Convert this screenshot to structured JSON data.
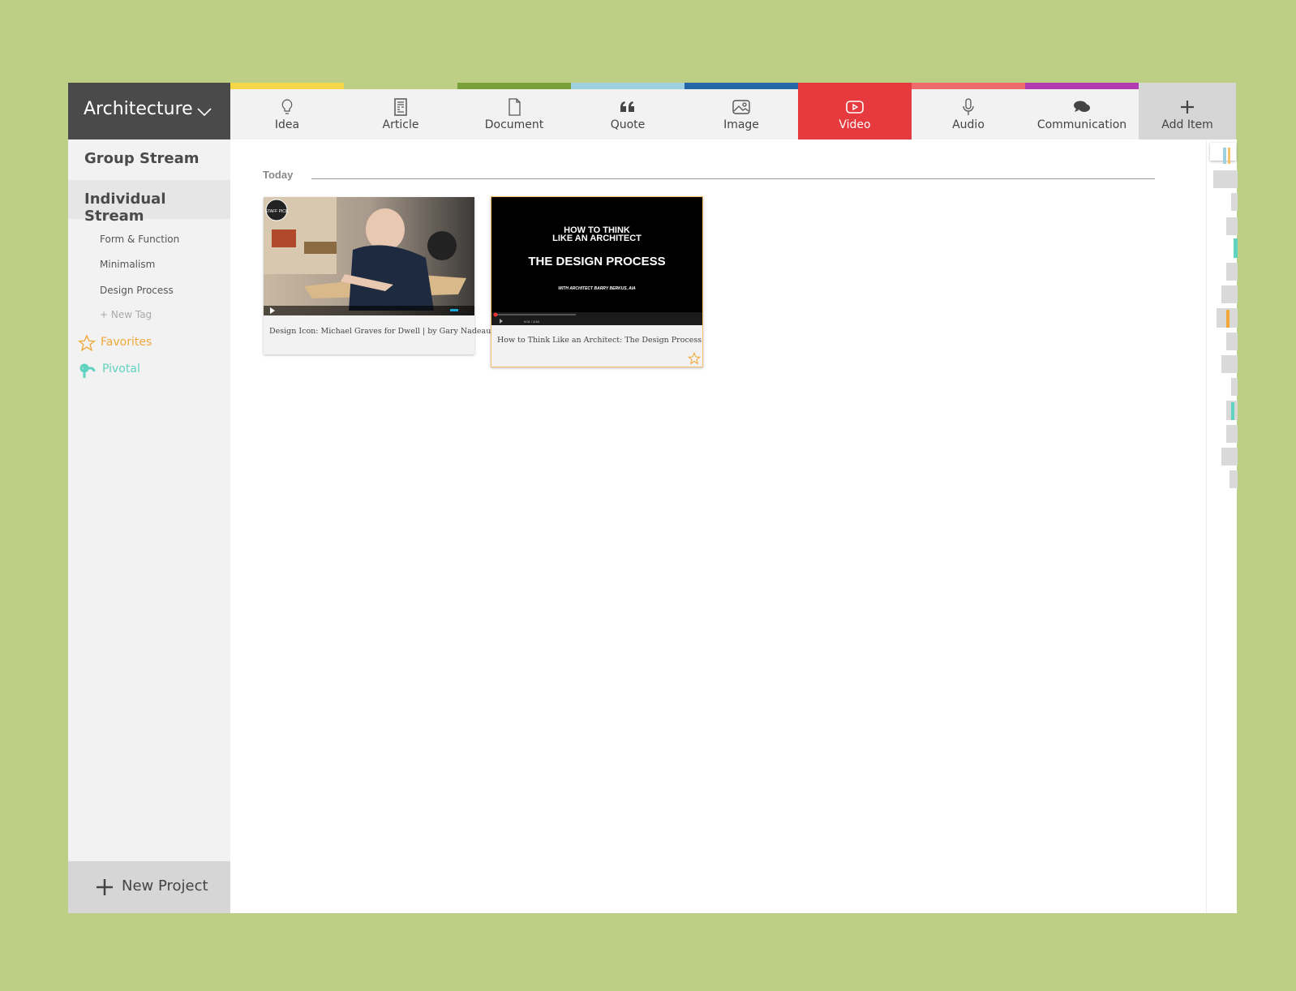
{
  "project": {
    "title": "Architecture"
  },
  "sidebar": {
    "group_stream": "Group Stream",
    "individual_stream": "Individual Stream",
    "tags": [
      "Form & Function",
      "Minimalism",
      "Design Process"
    ],
    "new_tag": "+ New Tag",
    "favorites": "Favorites",
    "pivotal": "Pivotal",
    "new_project": "New Project"
  },
  "toolbar": {
    "items": [
      {
        "label": "Idea",
        "color": "#f5d84a"
      },
      {
        "label": "Article",
        "color": "#bccf84"
      },
      {
        "label": "Document",
        "color": "#7aa03a"
      },
      {
        "label": "Quote",
        "color": "#9fd0e0"
      },
      {
        "label": "Image",
        "color": "#2566a8"
      },
      {
        "label": "Video",
        "color": "#e63a3f"
      },
      {
        "label": "Audio",
        "color": "#ef6a6a"
      },
      {
        "label": "Communication",
        "color": "#b03ab0"
      }
    ],
    "add_item": "Add Item",
    "active": "Video"
  },
  "stream": {
    "section": "Today",
    "cards": [
      {
        "caption": "Design Icon: Michael Graves for Dwell | by Gary Nadeau",
        "badge": "STAFF PICK"
      },
      {
        "caption": "How to Think Like an Architect: The Design Process",
        "video_title_1": "HOW TO THINK",
        "video_title_2": "LIKE AN ARCHITECT",
        "video_title_3": "THE DESIGN PROCESS",
        "video_sub": "WITH ARCHITECT BARRY BERKUS, AIA",
        "video_time": "0:01 / 3:54"
      }
    ]
  },
  "colors": {
    "accent_video": "#e63a3f",
    "favorites": "#f0a93a",
    "pivotal": "#5fd3c0",
    "background": "#bccf84"
  }
}
